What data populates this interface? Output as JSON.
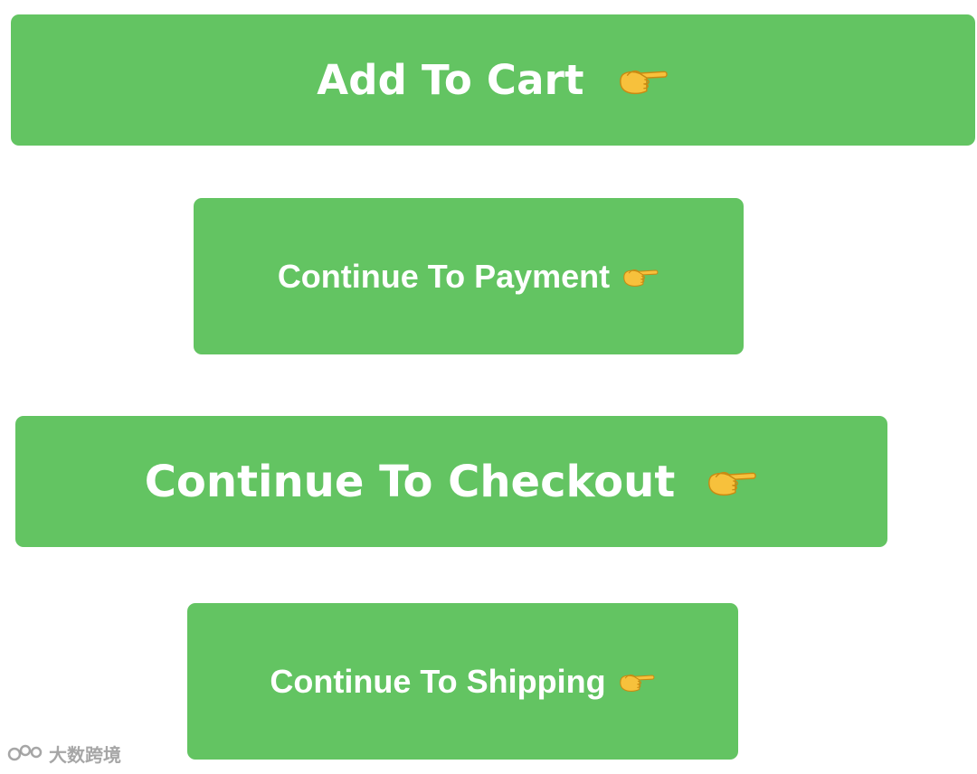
{
  "buttons": {
    "add_to_cart": {
      "label": "Add To Cart",
      "icon": "backhand-index-pointing-right-icon"
    },
    "continue_payment": {
      "label": "Continue To Payment",
      "icon": "backhand-index-pointing-right-icon"
    },
    "continue_checkout": {
      "label": "Continue To Checkout",
      "icon": "backhand-index-pointing-right-icon"
    },
    "continue_shipping": {
      "label": "Continue To Shipping",
      "icon": "backhand-index-pointing-right-icon"
    }
  },
  "watermark": {
    "text": "大数跨境"
  },
  "colors": {
    "button_bg": "#63c462",
    "button_text": "#ffffff",
    "emoji_yellow": "#f7c13c",
    "page_bg": "#ffffff"
  }
}
